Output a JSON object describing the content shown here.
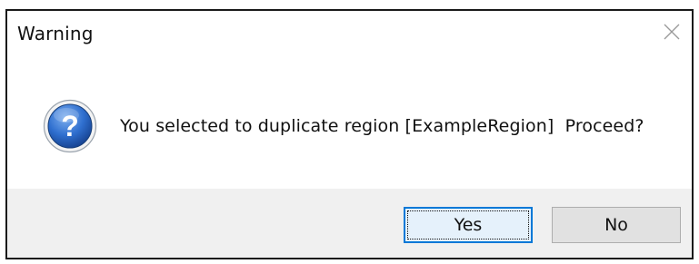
{
  "dialog": {
    "title": "Warning",
    "close_icon": "close-icon",
    "message_icon": "question-icon",
    "message": "You selected to duplicate region [ExampleRegion]  Proceed?",
    "buttons": {
      "yes_label": "Yes",
      "no_label": "No"
    },
    "colors": {
      "accent": "#0078d7",
      "footer_bg": "#f0f0f0",
      "icon_blue": "#1f5fb4"
    }
  }
}
